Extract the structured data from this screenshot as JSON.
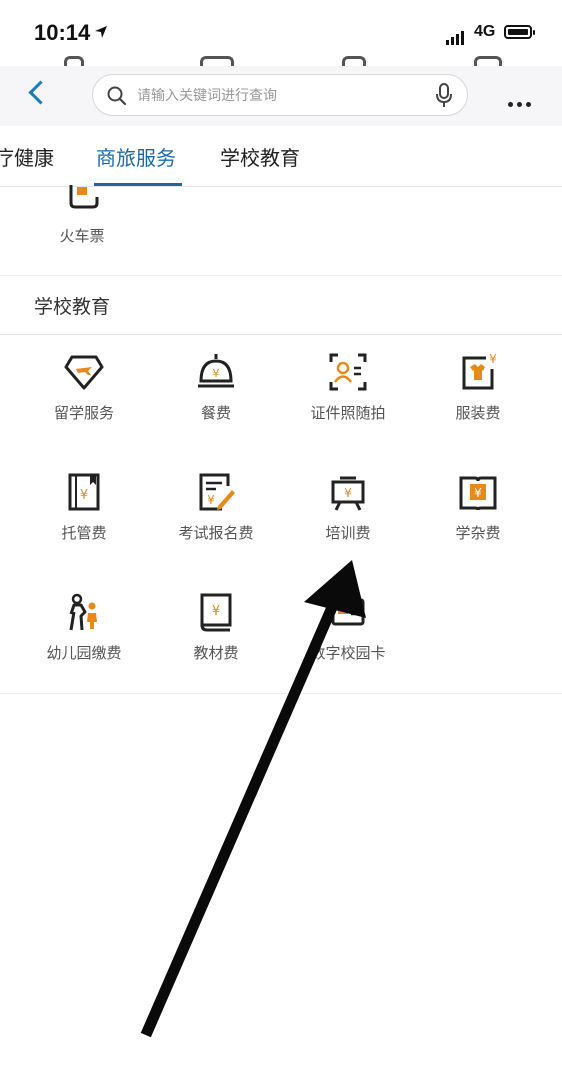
{
  "status": {
    "time": "10:14",
    "network": "4G"
  },
  "search": {
    "placeholder": "请输入关键词进行查询"
  },
  "tabs": [
    {
      "label": "疗健康"
    },
    {
      "label": "商旅服务"
    },
    {
      "label": "学校教育"
    }
  ],
  "prev_section": {
    "item_label": "火车票"
  },
  "school": {
    "title": "学校教育",
    "items": [
      {
        "label": "留学服务",
        "icon": "study-abroad-icon"
      },
      {
        "label": "餐费",
        "icon": "meal-bell-icon"
      },
      {
        "label": "证件照随拍",
        "icon": "id-photo-icon"
      },
      {
        "label": "服装费",
        "icon": "clothing-icon"
      },
      {
        "label": "托管费",
        "icon": "custody-book-icon"
      },
      {
        "label": "考试报名费",
        "icon": "exam-form-icon"
      },
      {
        "label": "培训费",
        "icon": "training-board-icon"
      },
      {
        "label": "学杂费",
        "icon": "tuition-book-icon"
      },
      {
        "label": "幼儿园缴费",
        "icon": "kindergarten-icon"
      },
      {
        "label": "教材费",
        "icon": "textbook-icon"
      },
      {
        "label": "数字校园卡",
        "icon": "campus-card-icon"
      }
    ]
  },
  "colors": {
    "accent": "#1a6aa8",
    "icon_orange": "#e88a1a",
    "icon_dark": "#222222"
  }
}
